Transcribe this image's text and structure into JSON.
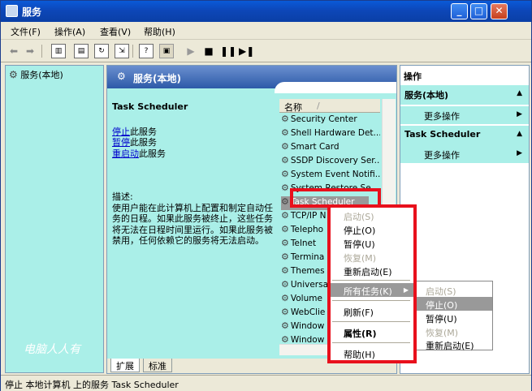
{
  "window": {
    "title": "服务"
  },
  "menubar": {
    "items": [
      "文件(F)",
      "操作(A)",
      "查看(V)",
      "帮助(H)"
    ]
  },
  "tree": {
    "root": "服务(本地)"
  },
  "center": {
    "header": "服务(本地)",
    "service_name": "Task Scheduler",
    "links": {
      "stop": "停止",
      "pause": "暂停",
      "restart": "重启动",
      "suffix": "此服务"
    },
    "desc_label": "描述:",
    "desc_text": "使用户能在此计算机上配置和制定自动任务的日程。如果此服务被终止，这些任务将无法在日程时间里运行。如果此服务被禁用，任何依赖它的服务将无法启动。",
    "column": "名称",
    "rows": [
      "Security Center",
      "Shell Hardware Det...",
      "Smart Card",
      "SSDP Discovery Ser...",
      "System Event Notifi...",
      "System Restore Se...",
      "Task Scheduler",
      "TCP/IP N",
      "Telepho",
      "Telnet",
      "Termina",
      "Themes",
      "Universa",
      "Volume",
      "WebClie",
      "Window",
      "Window"
    ],
    "tabs": [
      "扩展",
      "标准"
    ]
  },
  "actions": {
    "title": "操作",
    "section1": "服务(本地)",
    "more1": "更多操作",
    "section2": "Task Scheduler",
    "more2": "更多操作"
  },
  "context_menu": {
    "start": "启动(S)",
    "stop": "停止(O)",
    "pause": "暂停(U)",
    "resume": "恢复(M)",
    "restart": "重新启动(E)",
    "all_tasks": "所有任务(K)",
    "refresh": "刷新(F)",
    "properties": "属性(R)",
    "help": "帮助(H)"
  },
  "submenu": {
    "start": "启动(S)",
    "stop": "停止(O)",
    "pause": "暂停(U)",
    "resume": "恢复(M)",
    "restart": "重新启动(E)"
  },
  "status": "停止 本地计算机 上的服务 Task Scheduler",
  "watermark": "电脑人人有"
}
